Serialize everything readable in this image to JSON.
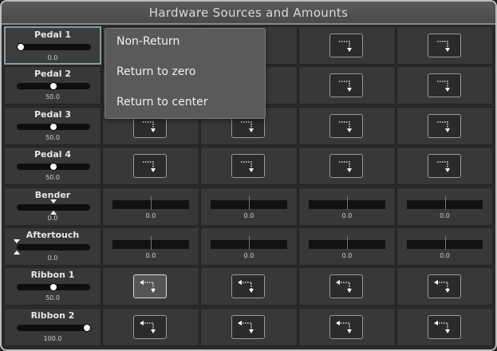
{
  "window": {
    "title": "Hardware Sources and Amounts"
  },
  "sources": [
    {
      "name": "Pedal 1",
      "value": "0.0",
      "level": 0.0,
      "bipolar": false,
      "selected": true
    },
    {
      "name": "Pedal 2",
      "value": "50.0",
      "level": 0.5,
      "bipolar": false
    },
    {
      "name": "Pedal 3",
      "value": "50.0",
      "level": 0.5,
      "bipolar": false
    },
    {
      "name": "Pedal 4",
      "value": "50.0",
      "level": 0.5,
      "bipolar": false
    },
    {
      "name": "Bender",
      "value": "0.0",
      "level": 0.5,
      "bipolar": true
    },
    {
      "name": "Aftertouch",
      "value": "0.0",
      "level": 0.0,
      "bipolar": true
    },
    {
      "name": "Ribbon 1",
      "value": "50.0",
      "level": 0.5,
      "bipolar": false
    },
    {
      "name": "Ribbon 2",
      "value": "100.0",
      "level": 1.0,
      "bipolar": false
    }
  ],
  "amount_rows": [
    {
      "type": "button",
      "icon": "return-icon",
      "columns": [
        "",
        "",
        "",
        ""
      ]
    },
    {
      "type": "button",
      "icon": "return-icon",
      "columns": [
        "",
        "",
        "",
        ""
      ]
    },
    {
      "type": "button",
      "icon": "return-icon",
      "columns": [
        "",
        "",
        "",
        ""
      ]
    },
    {
      "type": "button",
      "icon": "return-icon",
      "columns": [
        "",
        "",
        "",
        ""
      ]
    },
    {
      "type": "bar",
      "columns": [
        "0.0",
        "0.0",
        "0.0",
        "0.0"
      ]
    },
    {
      "type": "bar",
      "columns": [
        "0.0",
        "0.0",
        "0.0",
        "0.0"
      ]
    },
    {
      "type": "button",
      "icon": "return-center-icon",
      "highlight_column": 0,
      "columns": [
        "",
        "",
        "",
        ""
      ]
    },
    {
      "type": "button",
      "icon": "return-center-icon",
      "columns": [
        "",
        "",
        "",
        ""
      ]
    }
  ],
  "popup_menu": {
    "items": [
      {
        "label": "Non-Return"
      },
      {
        "label": "Return to zero"
      },
      {
        "label": "Return to center"
      }
    ]
  },
  "colors": {
    "title_bar": "#4f4f4f",
    "cell": "#383838",
    "accent": "#ffffff"
  }
}
